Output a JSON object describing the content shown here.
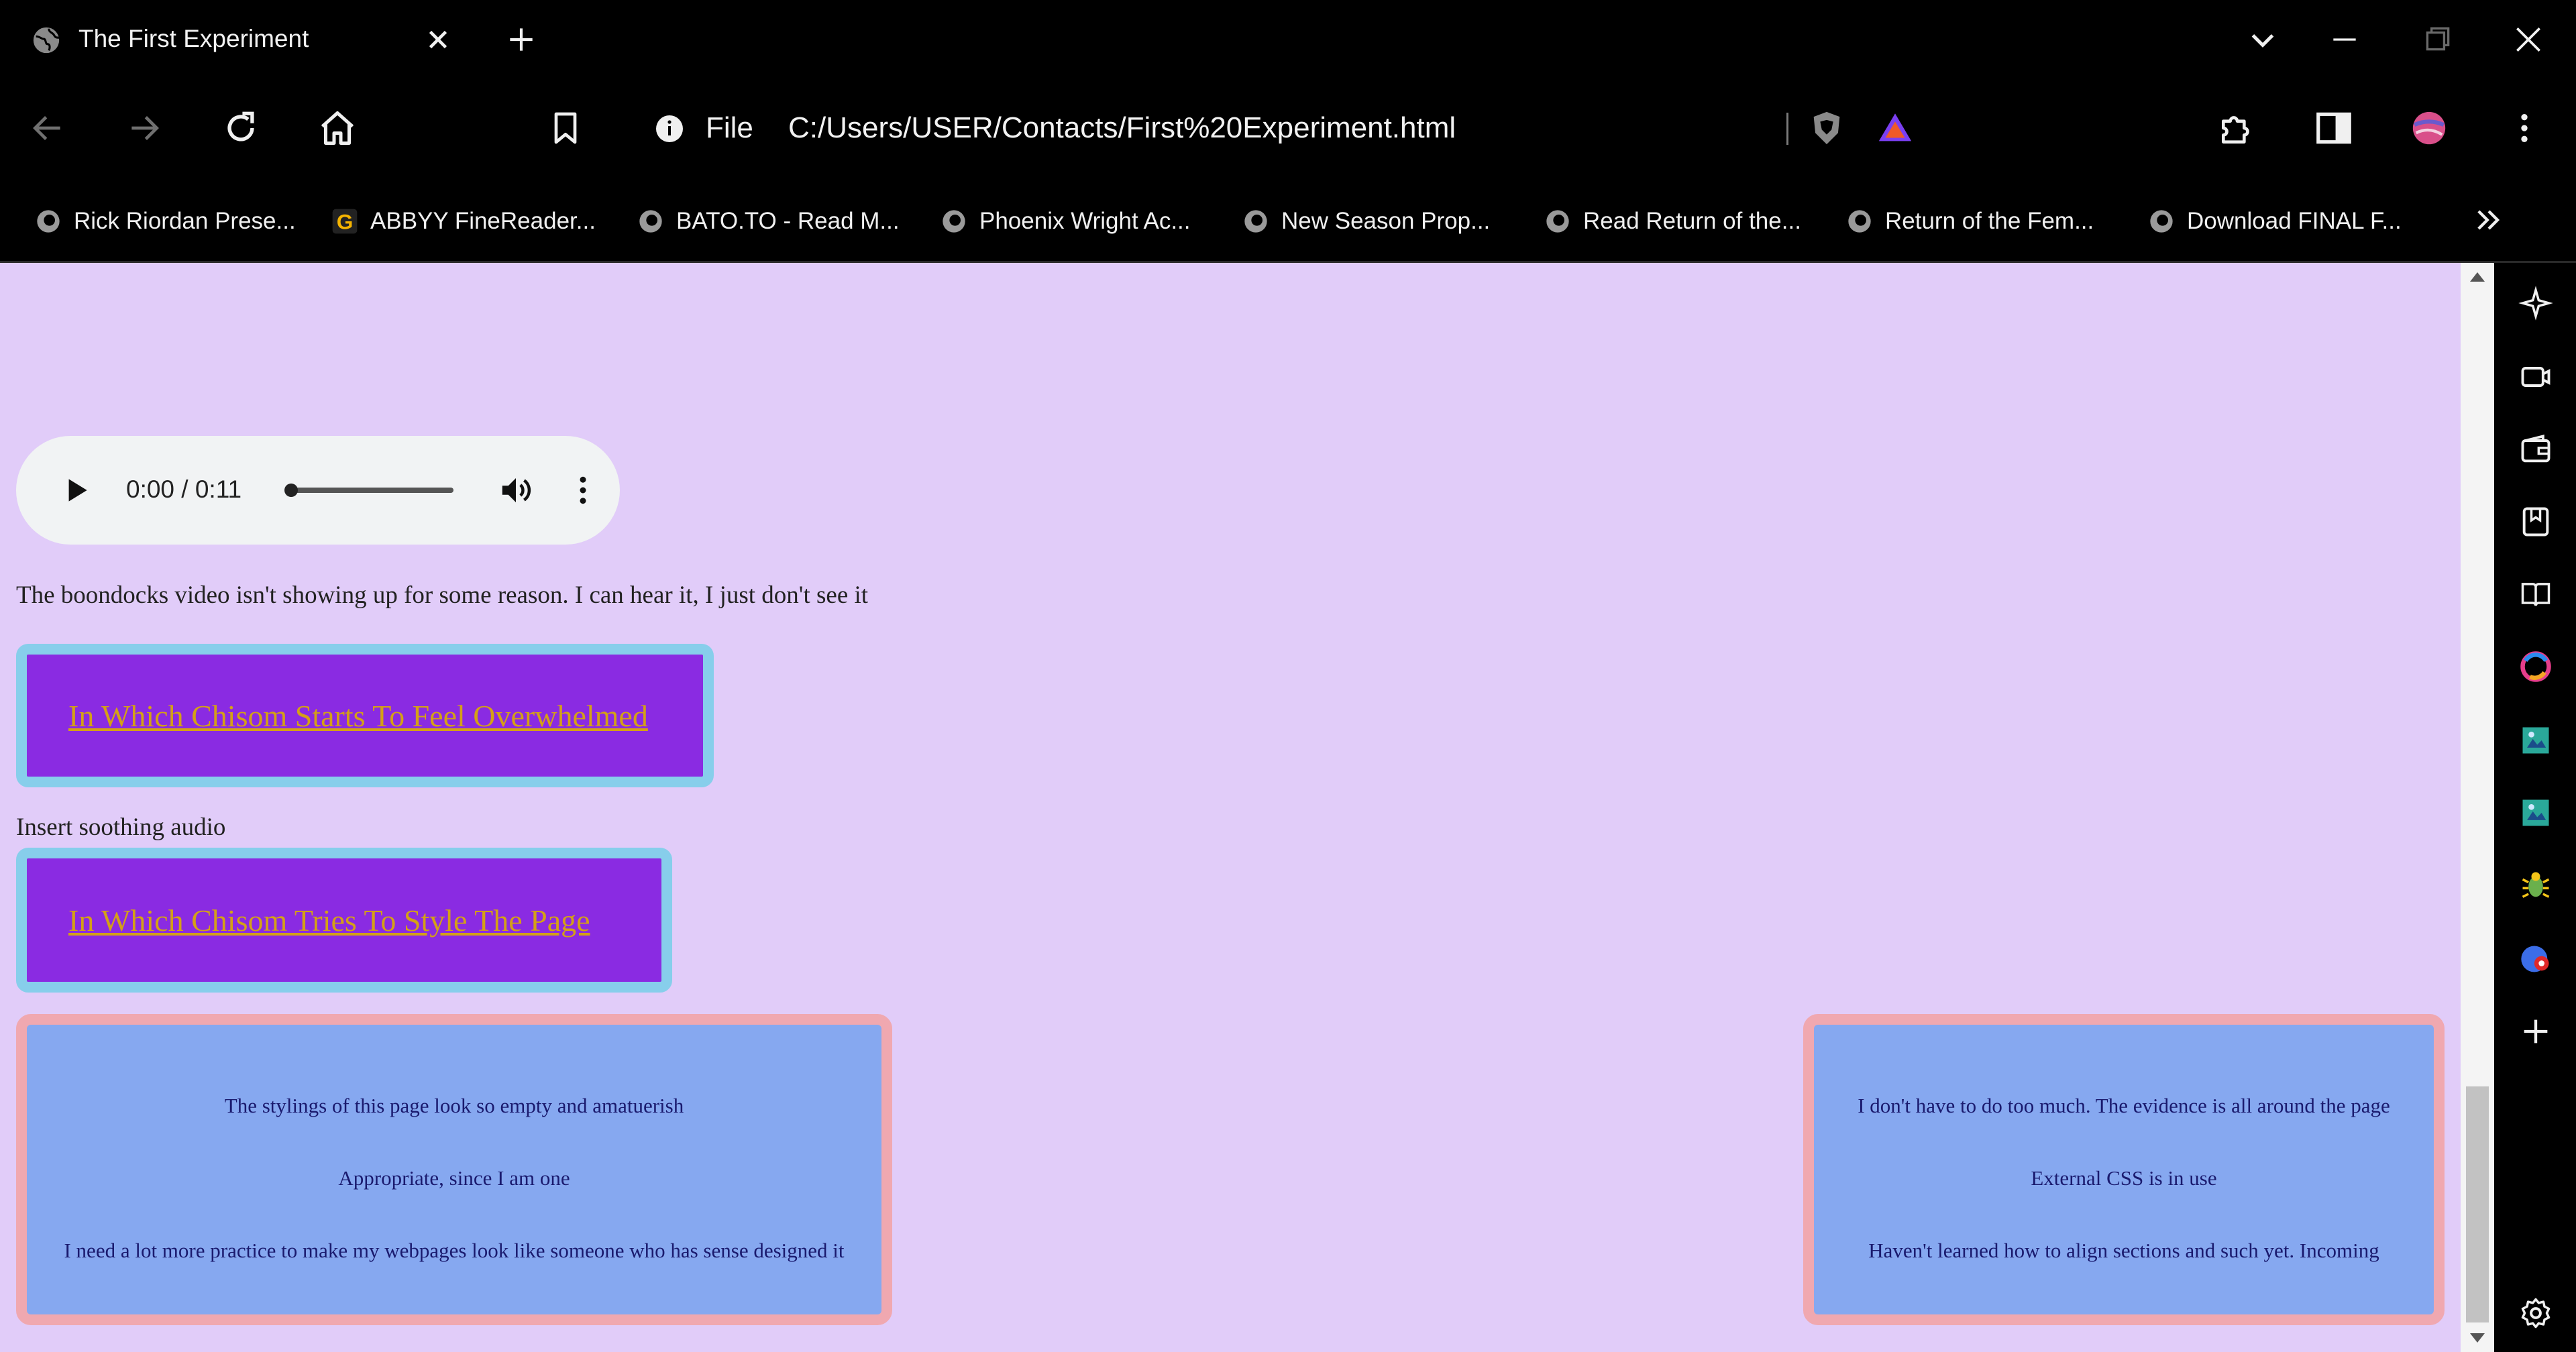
{
  "browser": {
    "tab": {
      "title": "The First Experiment"
    },
    "address": {
      "scheme": "File",
      "url": "C:/Users/USER/Contacts/First%20Experiment.html"
    },
    "bookmarks": [
      "Rick Riordan Prese...",
      "ABBYY FineReader...",
      "BATO.TO - Read M...",
      "Phoenix Wright Ac...",
      "New Season Prop...",
      "Read Return of the...",
      "Return of the Fem...",
      "Download FINAL F..."
    ],
    "icons": {
      "tab": [
        "globe-icon",
        "close-icon",
        "plus-icon"
      ],
      "window": [
        "chevron-down-icon",
        "minimize-icon",
        "restore-icon",
        "close-icon"
      ],
      "toolbar": [
        "back-icon",
        "forward-icon",
        "reload-icon",
        "home-icon",
        "bookmark-icon",
        "info-icon",
        "brave-shield-icon",
        "brave-rewards-icon",
        "extensions-icon",
        "sidebar-toggle-icon",
        "profile-avatar-icon",
        "menu-icon"
      ],
      "sidepanel": [
        "leo-ai-icon",
        "video-icon",
        "wallet-icon",
        "reading-list-icon",
        "reader-icon",
        "app-icon",
        "image-app-icon",
        "image-app-icon",
        "bug-icon",
        "record-icon",
        "add-icon",
        "settings-icon"
      ]
    }
  },
  "page": {
    "audio": {
      "time": "0:00 / 0:11",
      "progress": 0
    },
    "note_video": "The boondocks video isn't showing up for some reason. I can hear it, I just don't see it",
    "link1": "In Which Chisom Starts To Feel Overwhelmed",
    "note_audio": "Insert soothing audio",
    "link2": "In Which Chisom Tries To Style The Page",
    "card_left": [
      "The stylings of this page look so empty and amatuerish",
      "Appropriate, since I am one",
      "I need a lot more practice to make my webpages look like someone who has sense designed it"
    ],
    "card_right": [
      "I don't have to do too much. The evidence is all around the page",
      "External CSS is in use",
      "Haven't learned how to align sections and such yet. Incoming"
    ]
  },
  "colors": {
    "page_bg": "#e1ccf9",
    "link_box": "#8a2be2",
    "link_border": "#87ceeb",
    "link_text": "#d4a017",
    "card_bg": "#86a8f0",
    "card_border": "#f0a8b0",
    "card_text": "#1a1a6e"
  }
}
